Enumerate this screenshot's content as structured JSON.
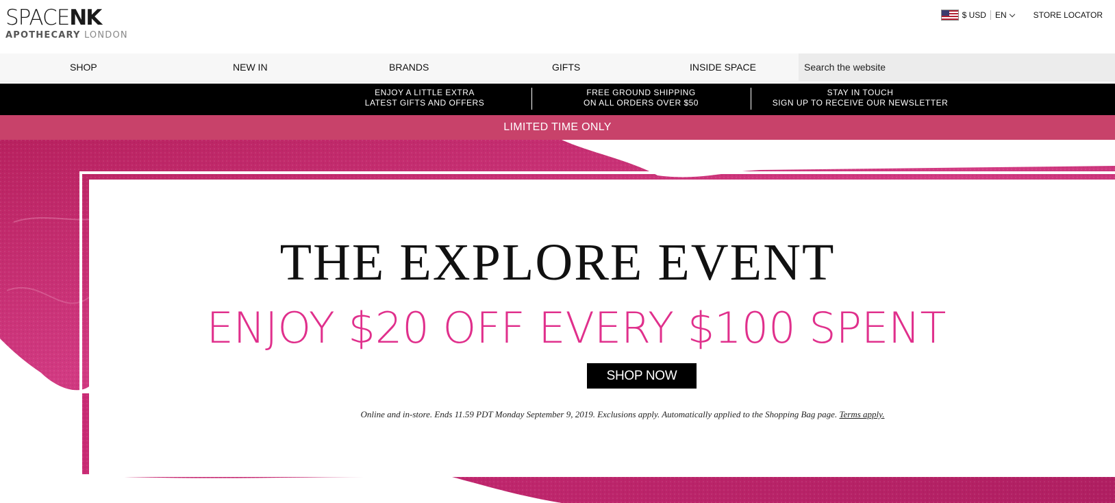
{
  "header": {
    "logo_main_a": "SPACE",
    "logo_main_b": "NK",
    "logo_sub_a": "APOTHECARY",
    "logo_sub_b": "LONDON",
    "currency": "$ USD",
    "language": "EN",
    "store_locator": "STORE LOCATOR"
  },
  "nav": {
    "items": [
      "SHOP",
      "NEW IN",
      "BRANDS",
      "GIFTS",
      "INSIDE SPACE"
    ],
    "search_placeholder": "Search the website"
  },
  "promo": {
    "items": [
      {
        "line1": "ENJOY A LITTLE EXTRA",
        "line2": "LATEST GIFTS AND OFFERS"
      },
      {
        "line1": "FREE GROUND SHIPPING",
        "line2": "ON ALL ORDERS OVER $50"
      },
      {
        "line1": "STAY IN TOUCH",
        "line2": "SIGN UP TO RECEIVE OUR NEWSLETTER"
      }
    ]
  },
  "banner": {
    "limited": "LIMITED TIME ONLY"
  },
  "hero": {
    "headline": "THE EXPLORE EVENT",
    "subline": "ENJOY $20 OFF EVERY $100 SPENT",
    "cta": "SHOP NOW",
    "terms_text": "Online and in-store. Ends 11.59 PDT Monday September 9, 2019. Exclusions apply. Automatically applied to the Shopping Bag page.",
    "terms_link": "Terms apply."
  },
  "colors": {
    "accent_pink": "#e0308c",
    "banner_pink": "#c8426a",
    "smear_pink": "#c2286e"
  }
}
